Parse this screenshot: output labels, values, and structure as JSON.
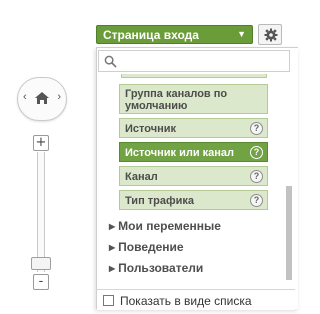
{
  "dimension_selector": {
    "selected_label": "Страница входа",
    "search_placeholder": "",
    "partial_top_label": "",
    "options": [
      {
        "label_line1": "Группа каналов по",
        "label_line2": "умолчанию",
        "has_help": false,
        "active": false
      },
      {
        "label": "Источник",
        "has_help": true,
        "help_symbol": "?",
        "active": false
      },
      {
        "label": "Источник или канал",
        "has_help": true,
        "help_symbol": "?",
        "active": true
      },
      {
        "label": "Канал",
        "has_help": true,
        "help_symbol": "?",
        "active": false
      },
      {
        "label": "Тип трафика",
        "has_help": true,
        "help_symbol": "?",
        "active": false
      }
    ],
    "groups": [
      {
        "label": "Мои переменные"
      },
      {
        "label": "Поведение"
      },
      {
        "label": "Пользователи"
      }
    ],
    "footer": {
      "show_as_list_label": "Показать в виде списка",
      "checked": false
    }
  },
  "map_controls": {
    "zoom_in_symbol": "+",
    "zoom_out_symbol": "-",
    "left_arrow": "‹",
    "right_arrow": "›",
    "zoom_level_fraction": 0.1
  },
  "colors": {
    "accent_green": "#6a9c3a",
    "option_bg": "#dce8cc",
    "active_option_bg": "#71a244"
  },
  "icons": {
    "gear": "gear-icon",
    "search": "search-icon",
    "home": "home-icon",
    "dropdown": "chevron-down-icon",
    "help": "help-icon",
    "group_expand": "triangle-right-icon"
  }
}
